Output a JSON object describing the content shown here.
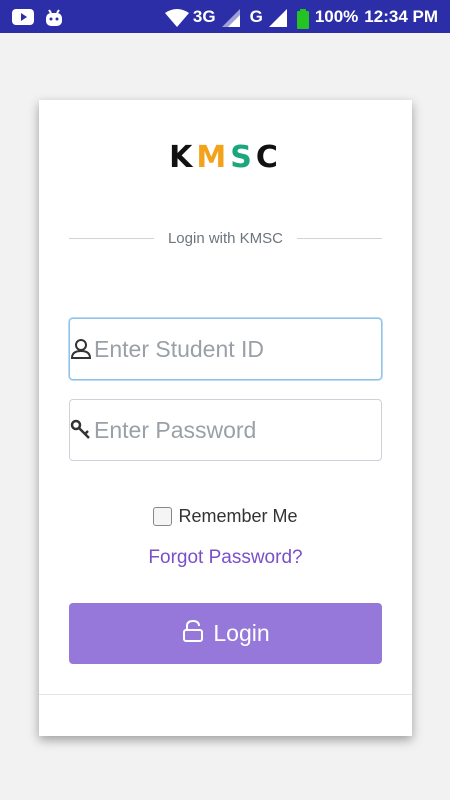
{
  "status_bar": {
    "network_1": "3G",
    "network_2": "G",
    "battery": "100%",
    "time": "12:34 PM",
    "icons": [
      "youtube-icon",
      "android-icon",
      "wifi-icon",
      "signal-icon",
      "battery-icon"
    ]
  },
  "logo": {
    "k": "K",
    "m": "M",
    "s": "S",
    "c": "C"
  },
  "login": {
    "divider_text": "Login with KMSC",
    "student_id_placeholder": "Enter Student ID",
    "password_placeholder": "Enter Password",
    "remember_label": "Remember Me",
    "forgot_label": "Forgot Password?",
    "login_label": "Login"
  },
  "colors": {
    "status_bar": "#2c2ea7",
    "accent": "#9678db",
    "link": "#7a4fc9",
    "logo_m": "#f3a21b",
    "logo_s": "#1aa77c"
  }
}
